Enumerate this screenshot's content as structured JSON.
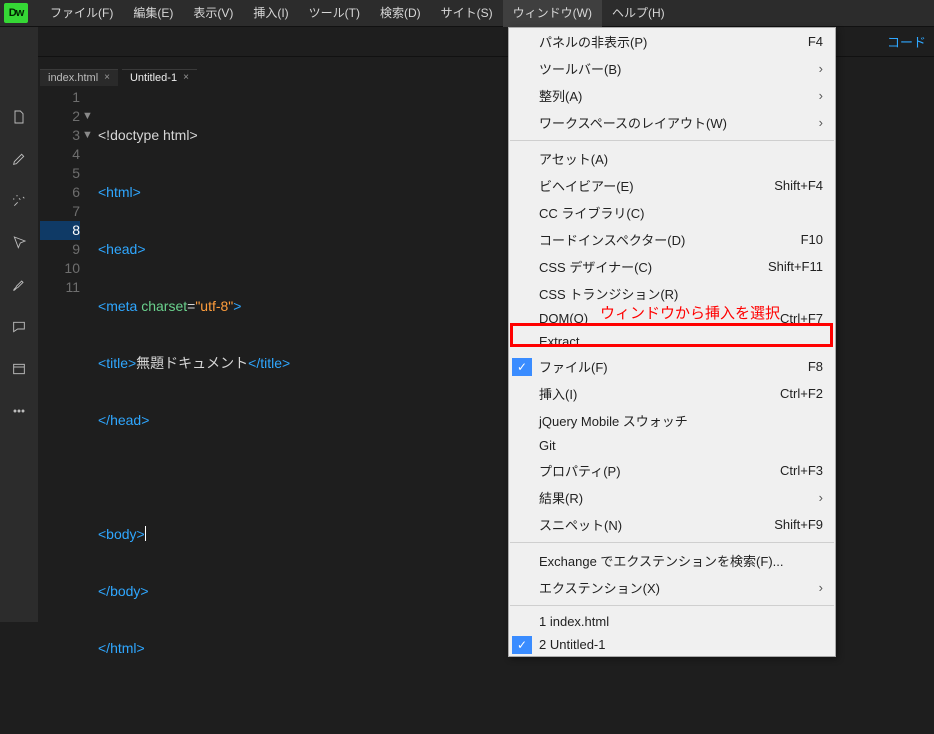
{
  "app": {
    "icon_text": "Dw"
  },
  "menubar": [
    "ファイル(F)",
    "編集(E)",
    "表示(V)",
    "挿入(I)",
    "ツール(T)",
    "検索(D)",
    "サイト(S)",
    "ウィンドウ(W)",
    "ヘルプ(H)"
  ],
  "open_menu_index": 7,
  "toolbar_right": "コード",
  "tabs": [
    {
      "label": "index.html",
      "active": false
    },
    {
      "label": "Untitled-1",
      "active": true
    }
  ],
  "code_lines": {
    "l1": "<!doctype html>",
    "l2": "<html>",
    "l3": "<head>",
    "l4a": "<",
    "l4b": "meta ",
    "l4c": "charset",
    "l4d": "=",
    "l4e": "\"utf-8\"",
    "l4f": ">",
    "l5a": "<",
    "l5b": "title",
    "l5c": ">",
    "l5d": "無題ドキュメント",
    "l5e": "</",
    "l5f": "title",
    "l5g": ">",
    "l6": "</head>",
    "l7": "",
    "l8": "<body>",
    "l9": "</body>",
    "l10": "</html>"
  },
  "line_numbers": [
    "1",
    "2",
    "3",
    "4",
    "5",
    "6",
    "7",
    "8",
    "9",
    "10",
    "11"
  ],
  "current_line_index": 7,
  "annotation": "ウィンドウから挿入を選択",
  "menu": {
    "sections": [
      [
        {
          "label": "パネルの非表示(P)",
          "shortcut": "F4"
        },
        {
          "label": "ツールバー(B)",
          "sub": true
        },
        {
          "label": "整列(A)",
          "sub": true
        },
        {
          "label": "ワークスペースのレイアウト(W)",
          "sub": true
        }
      ],
      [
        {
          "label": "アセット(A)"
        },
        {
          "label": "ビヘイビアー(E)",
          "shortcut": "Shift+F4"
        },
        {
          "label": "CC ライブラリ(C)"
        },
        {
          "label": "コードインスペクター(D)",
          "shortcut": "F10"
        },
        {
          "label": "CSS デザイナー(C)",
          "shortcut": "Shift+F11"
        },
        {
          "label": "CSS トランジション(R)"
        },
        {
          "label": "DOM(O)",
          "shortcut": "Ctrl+F7"
        },
        {
          "label": "Extract"
        },
        {
          "label": "ファイル(F)",
          "shortcut": "F8",
          "checked": true
        },
        {
          "label": "挿入(I)",
          "shortcut": "Ctrl+F2",
          "highlighted": true
        },
        {
          "label": "jQuery Mobile スウォッチ"
        },
        {
          "label": "Git"
        },
        {
          "label": "プロパティ(P)",
          "shortcut": "Ctrl+F3"
        },
        {
          "label": "結果(R)",
          "sub": true
        },
        {
          "label": "スニペット(N)",
          "shortcut": "Shift+F9"
        }
      ],
      [
        {
          "label": "Exchange でエクステンションを検索(F)..."
        },
        {
          "label": "エクステンション(X)",
          "sub": true
        }
      ],
      [
        {
          "label": "1 index.html"
        },
        {
          "label": "2 Untitled-1",
          "checked": true
        }
      ]
    ]
  }
}
